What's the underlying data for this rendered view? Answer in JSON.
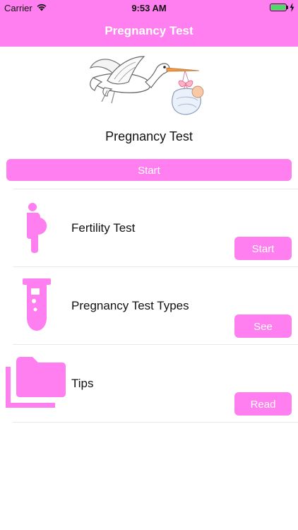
{
  "status_bar": {
    "carrier": "Carrier",
    "time": "9:53 AM"
  },
  "nav": {
    "title": "Pregnancy Test"
  },
  "hero": {
    "title": "Pregnancy Test",
    "start_label": "Start"
  },
  "rows": [
    {
      "label": "Fertility Test",
      "button": "Start",
      "icon": "pregnant-woman-icon"
    },
    {
      "label": "Pregnancy Test Types",
      "button": "See",
      "icon": "test-tube-icon"
    },
    {
      "label": "Tips",
      "button": "Read",
      "icon": "folder-icon"
    }
  ],
  "colors": {
    "accent": "#ff7ff0",
    "battery": "#4cd964"
  }
}
